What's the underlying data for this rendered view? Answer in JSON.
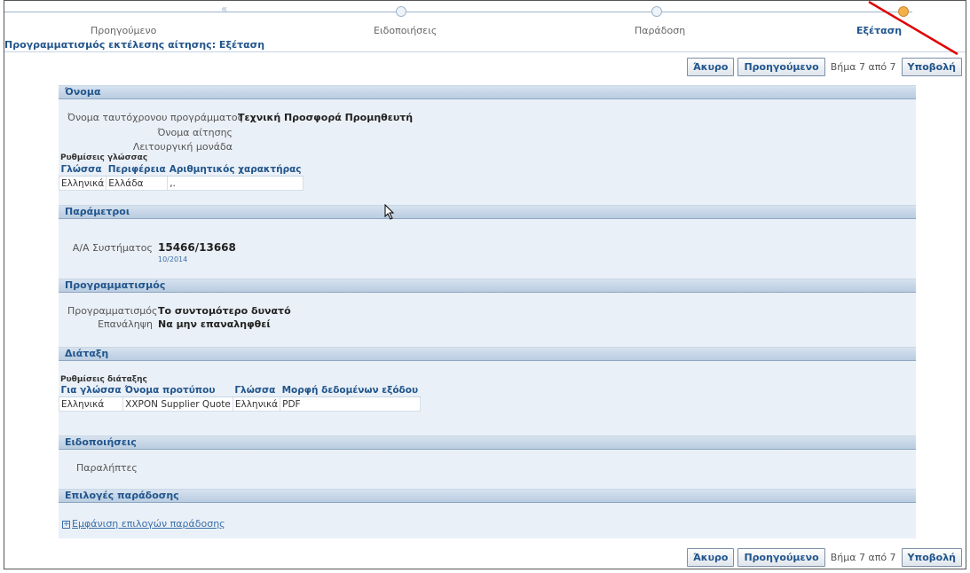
{
  "train": {
    "steps": [
      "Προηγούμενο",
      "Ειδοποιήσεις",
      "Παράδοση",
      "Εξέταση"
    ]
  },
  "page_title": "Προγραμματισμός εκτέλεσης αίτησης: Εξέταση",
  "buttons": {
    "cancel": "Άκυρο",
    "back": "Προηγούμενο",
    "step_info": "Βήμα 7 από 7",
    "submit": "Υποβολή"
  },
  "sections": {
    "name": {
      "title": "Όνομα",
      "fields": [
        {
          "label": "Όνομα ταυτόχρονου προγράμματος",
          "value": "Τεχνική Προσφορά Προμηθευτή"
        },
        {
          "label": "Όνομα αίτησης",
          "value": ""
        },
        {
          "label": "Λειτουργική μονάδα",
          "value": ""
        }
      ],
      "lang_settings_label": "Ρυθμίσεις γλώσσας",
      "lang_table": {
        "headers": [
          "Γλώσσα",
          "Περιφέρεια",
          "Αριθμητικός χαρακτήρας"
        ],
        "rows": [
          [
            "Ελληνικά",
            "Ελλάδα",
            ",."
          ]
        ]
      }
    },
    "params": {
      "title": "Παράμετροι",
      "label": "Α/Α Συστήματος",
      "value": "15466/13668",
      "subvalue": "10/2014"
    },
    "schedule": {
      "title": "Προγραμματισμός",
      "fields": [
        {
          "label": "Προγραμματισμός",
          "value": "Το συντομότερο δυνατό"
        },
        {
          "label": "Επανάληψη",
          "value": "Να μην επαναληφθεί"
        }
      ]
    },
    "layout": {
      "title": "Διάταξη",
      "settings_label": "Ρυθμίσεις διάταξης",
      "table": {
        "headers": [
          "Για γλώσσα",
          "Όνομα προτύπου",
          "Γλώσσα",
          "Μορφή δεδομένων εξόδου"
        ],
        "rows": [
          [
            "Ελληνικά",
            "XXPON Supplier Quote",
            "Ελληνικά",
            "PDF"
          ]
        ]
      }
    },
    "notifications": {
      "title": "Ειδοποιήσεις",
      "label": "Παραλήπτες"
    },
    "delivery": {
      "title": "Επιλογές παράδοσης",
      "link": "Εμφάνιση επιλογών παράδοσης"
    }
  },
  "colors": {
    "accent": "#21558c",
    "current_step": "#f4b04a",
    "annotation_arrow": "#e00000"
  }
}
